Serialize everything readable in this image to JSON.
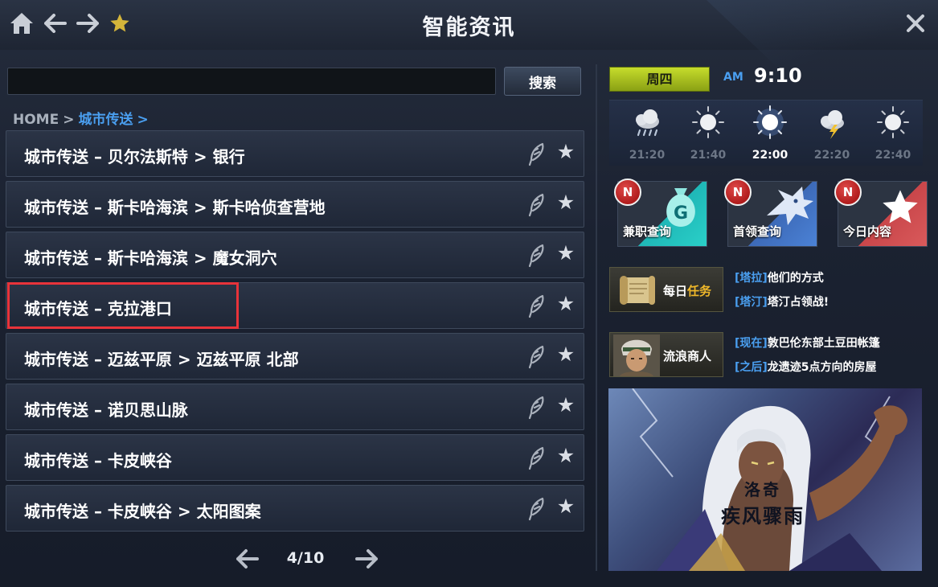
{
  "window": {
    "title": "智能资讯"
  },
  "toolbar": {
    "home": "home-icon",
    "back": "arrow-left-icon",
    "forward": "arrow-right-icon",
    "favorite": "star-icon",
    "close": "close-icon"
  },
  "search": {
    "value": "",
    "placeholder": "",
    "button_label": "搜索"
  },
  "breadcrumb": {
    "home": "HOME",
    "current": "城市传送",
    "sep": ">"
  },
  "list": {
    "items": [
      {
        "label": "城市传送 – 贝尔法斯特 > 银行"
      },
      {
        "label": "城市传送 – 斯卡哈海滨 > 斯卡哈侦查营地"
      },
      {
        "label": "城市传送 – 斯卡哈海滨 > 魔女洞穴"
      },
      {
        "label": "城市传送 – 克拉港口"
      },
      {
        "label": "城市传送 – 迈兹平原 > 迈兹平原 北部"
      },
      {
        "label": "城市传送 – 诺贝思山脉"
      },
      {
        "label": "城市传送 – 卡皮峡谷"
      },
      {
        "label": "城市传送 – 卡皮峡谷 > 太阳图案"
      }
    ],
    "highlighted_index": 3
  },
  "pager": {
    "text": "4/10"
  },
  "status": {
    "day": "周四",
    "ampm": "AM",
    "time": "9:10"
  },
  "weather": [
    {
      "time": "21:20",
      "icon": "rain-cloud-icon",
      "active": false
    },
    {
      "time": "21:40",
      "icon": "sun-icon",
      "active": false
    },
    {
      "time": "22:00",
      "icon": "sun-icon",
      "active": true
    },
    {
      "time": "22:20",
      "icon": "thunder-cloud-icon",
      "active": false
    },
    {
      "time": "22:40",
      "icon": "sun-icon",
      "active": false
    }
  ],
  "shortcuts": [
    {
      "label": "兼职查询",
      "badge": "N"
    },
    {
      "label": "首领查询",
      "badge": "N"
    },
    {
      "label": "今日内容",
      "badge": "N"
    }
  ],
  "daily_quest": {
    "label_prefix": "每日",
    "label_highlight": "任务",
    "news": [
      {
        "tag": "[塔拉]",
        "text": "他们的方式"
      },
      {
        "tag": "[塔汀]",
        "text": "塔汀占领战!"
      }
    ]
  },
  "merchant": {
    "label": "流浪商人",
    "news": [
      {
        "tag": "[现在]",
        "text": "敦巴伦东部土豆田帐篷"
      },
      {
        "tag": "[之后]",
        "text": "龙遗迹5点方向的房屋"
      }
    ]
  },
  "banner": {
    "line1": "洛奇",
    "line2": "疾风骤雨"
  },
  "colors": {
    "accent_blue": "#4a9ff0",
    "highlight_red": "#e8333a",
    "day_badge": "#b5cc22",
    "gold": "#f0b82a"
  }
}
